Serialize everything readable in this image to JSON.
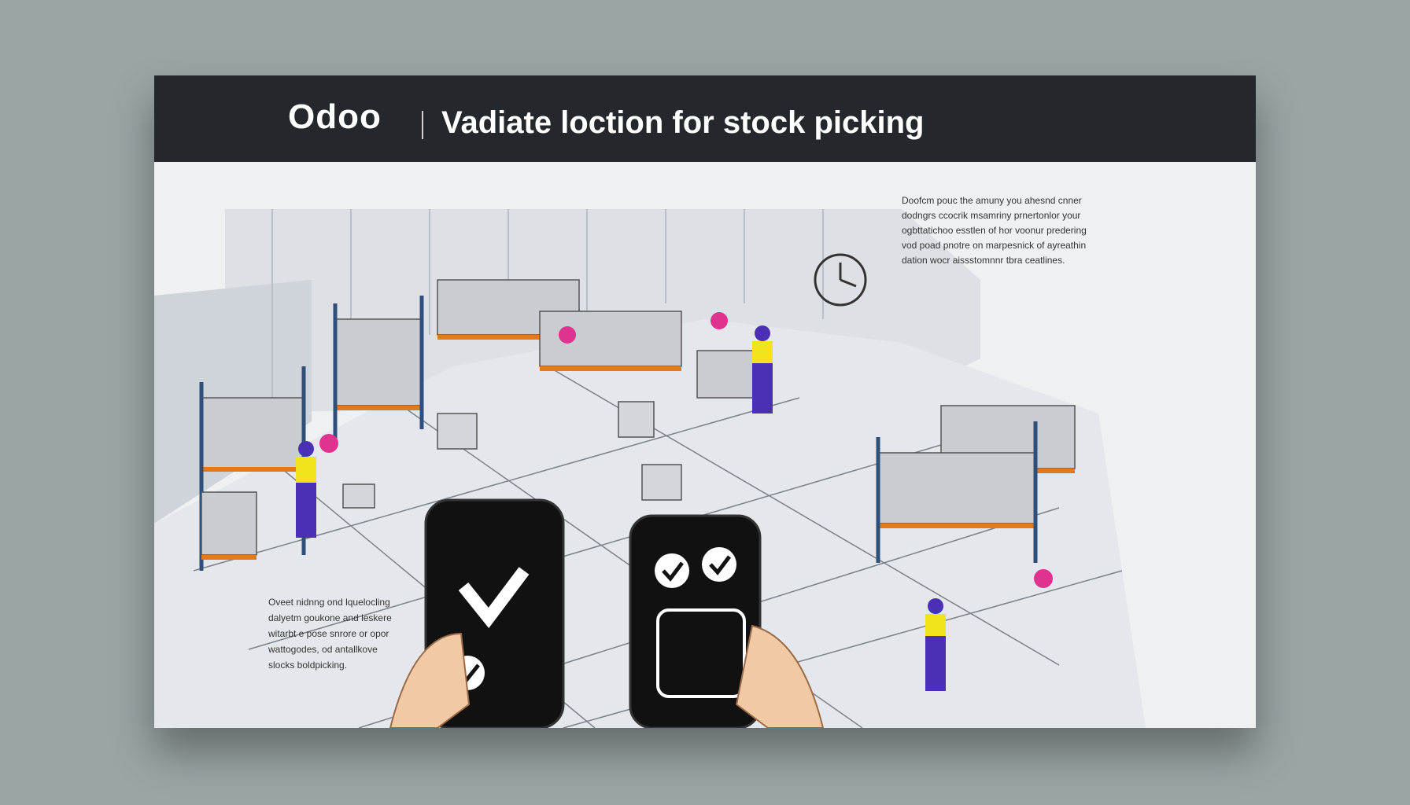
{
  "header": {
    "brand": "Odoo",
    "title": "Vadiate loction for stock  picking"
  },
  "panel_right_text": [
    "Doofcm pouc the amuny you ahesnd cnner",
    "dodngrs ccocrik msamriny prnertonlor your",
    "ogbttatichoo esstlen of hor voonur predering",
    "vod poad pnotre on marpesnick of ayreathin",
    "dation wocr aissstomnnr tbra ceatlines."
  ],
  "panel_left_text": [
    "Oveet nidnng ond lquelocling",
    "dalyetm goukone and leskere",
    "witarbt e pose snrore or opor",
    "wattogodes, od antallkove",
    "slocks boldpicking."
  ],
  "colors": {
    "header_bg": "#24272b",
    "panel_bg": "#eef0f2",
    "page_bg": "#9aa5a6",
    "accent_pin": "#e0338f",
    "worker_overalls": "#4b2fb5",
    "worker_shirt": "#f2e31c",
    "rack_orange": "#e07a1f",
    "rack_blue": "#2e4f7a"
  }
}
